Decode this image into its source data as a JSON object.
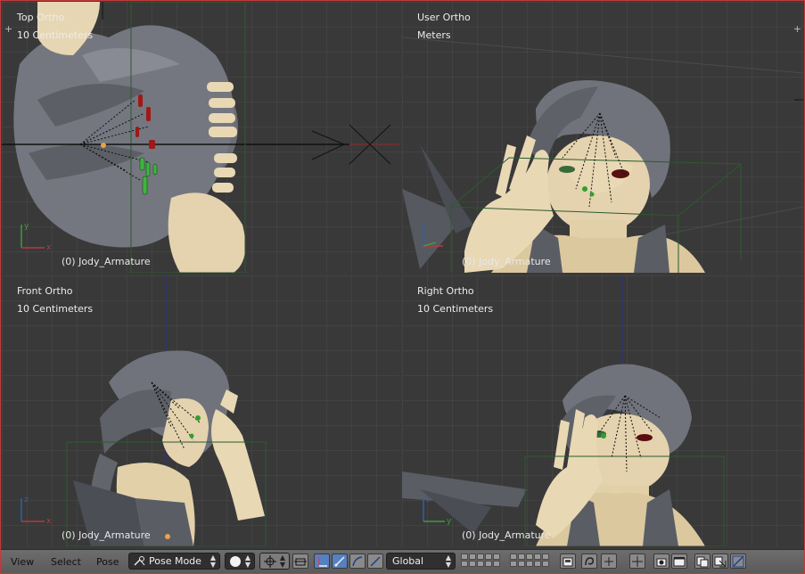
{
  "viewports": {
    "top_left": {
      "title": "Top Ortho",
      "scale": "10 Centimeters",
      "object": "(0) Jody_Armature"
    },
    "top_right": {
      "title": "User Ortho",
      "scale": "Meters",
      "object": "(0) Jody_Armature"
    },
    "bottom_left": {
      "title": "Front Ortho",
      "scale": "10 Centimeters",
      "object": "(0) Jody_Armature"
    },
    "bottom_right": {
      "title": "Right Ortho",
      "scale": "10 Centimeters",
      "object": "(0) Jody_Armature"
    }
  },
  "header": {
    "menu": [
      "View",
      "Select",
      "Pose"
    ],
    "mode": "Pose Mode",
    "orientation": "Global",
    "icons": [
      "mode-icon",
      "shading-sphere-icon",
      "pivot-icon",
      "manipulator-icon",
      "translate-icon",
      "rotate-icon",
      "scale-icon",
      "pose-lock-icon",
      "copy-pose-icon",
      "paste-pose-icon",
      "paste-flipped-icon",
      "render-icon",
      "camera-icon"
    ]
  },
  "colors": {
    "accent": "#5680c2",
    "viewport_bg": "#393939",
    "header_bg": "#616161",
    "frame_border": "#c43a3a",
    "bone_select": "#1faa1f",
    "bone_active": "#b01c1c"
  }
}
